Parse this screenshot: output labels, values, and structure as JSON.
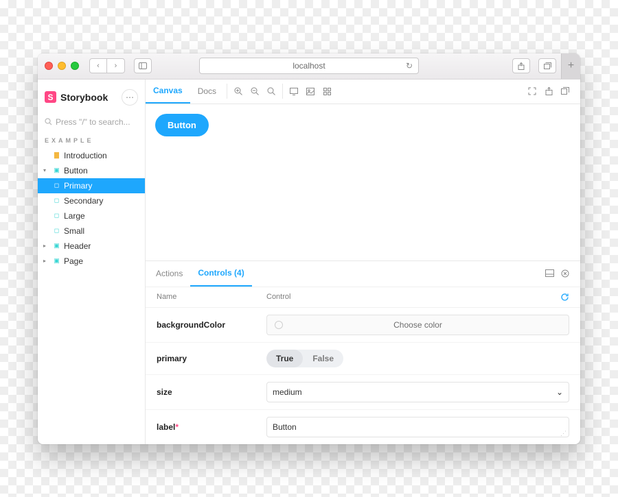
{
  "browser": {
    "url_text": "localhost"
  },
  "sidebar": {
    "logo_text": "Storybook",
    "search_placeholder": "Press \"/\" to search...",
    "section_label": "EXAMPLE",
    "items": [
      {
        "label": "Introduction"
      },
      {
        "label": "Button"
      },
      {
        "label": "Primary"
      },
      {
        "label": "Secondary"
      },
      {
        "label": "Large"
      },
      {
        "label": "Small"
      },
      {
        "label": "Header"
      },
      {
        "label": "Page"
      }
    ]
  },
  "toolbar": {
    "tab_canvas": "Canvas",
    "tab_docs": "Docs"
  },
  "preview": {
    "button_label": "Button"
  },
  "addons": {
    "tab_actions": "Actions",
    "tab_controls": "Controls (4)",
    "head_name": "Name",
    "head_control": "Control",
    "rows": {
      "backgroundColor": {
        "name": "backgroundColor",
        "placeholder": "Choose color"
      },
      "primary": {
        "name": "primary",
        "true": "True",
        "false": "False"
      },
      "size": {
        "name": "size",
        "value": "medium"
      },
      "label": {
        "name": "label",
        "required_mark": "*",
        "value": "Button"
      }
    }
  }
}
